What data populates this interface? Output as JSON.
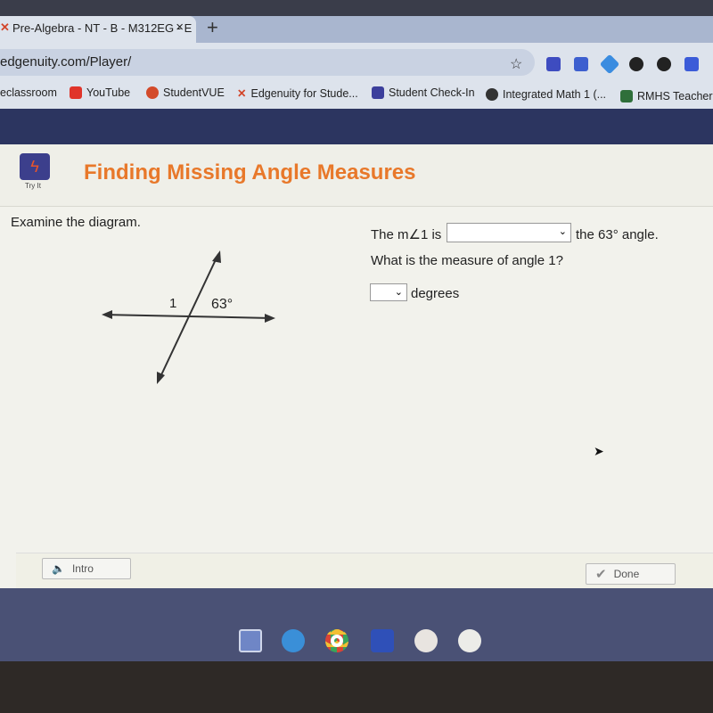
{
  "browser": {
    "tab_title": "Pre-Algebra - NT - B - M312EG - E",
    "tab_close": "×",
    "new_tab": "+",
    "url": "edgenuity.com/Player/",
    "star_icon": "☆",
    "bookmarks": [
      {
        "label": "eclassroom",
        "icon": "classroom-icon",
        "color": ""
      },
      {
        "label": "YouTube",
        "icon": "youtube-icon",
        "color": "#e0342a"
      },
      {
        "label": "StudentVUE",
        "icon": "studentvue-icon",
        "color": "#d34a2a"
      },
      {
        "label": "Edgenuity for Stude...",
        "icon": "edgenuity-icon",
        "color": "#d2452a"
      },
      {
        "label": "Student Check-In",
        "icon": "form-icon",
        "color": "#3c3f9c"
      },
      {
        "label": "Integrated Math 1 (...",
        "icon": "webcam-icon",
        "color": "#333333"
      },
      {
        "label": "RMHS Teacher I",
        "icon": "plus-icon",
        "color": "#2f6f3a"
      }
    ]
  },
  "lesson": {
    "badge": "Try It",
    "title": "Finding Missing Angle Measures",
    "instruction": "Examine the diagram.",
    "diagram": {
      "angle1_label": "1",
      "angle_label": "63°"
    },
    "q1_before": "The m∠1 is",
    "q1_dropdown_value": "",
    "q1_after": "the 63° angle.",
    "q2": "What is the measure of angle 1?",
    "q2_dropdown_value": "",
    "q2_unit": "degrees"
  },
  "footer": {
    "intro_label": "Intro",
    "done_label": "Done"
  },
  "colors": {
    "title": "#e8782a",
    "badge": "#3c3f8c",
    "band": "#2c3560"
  }
}
